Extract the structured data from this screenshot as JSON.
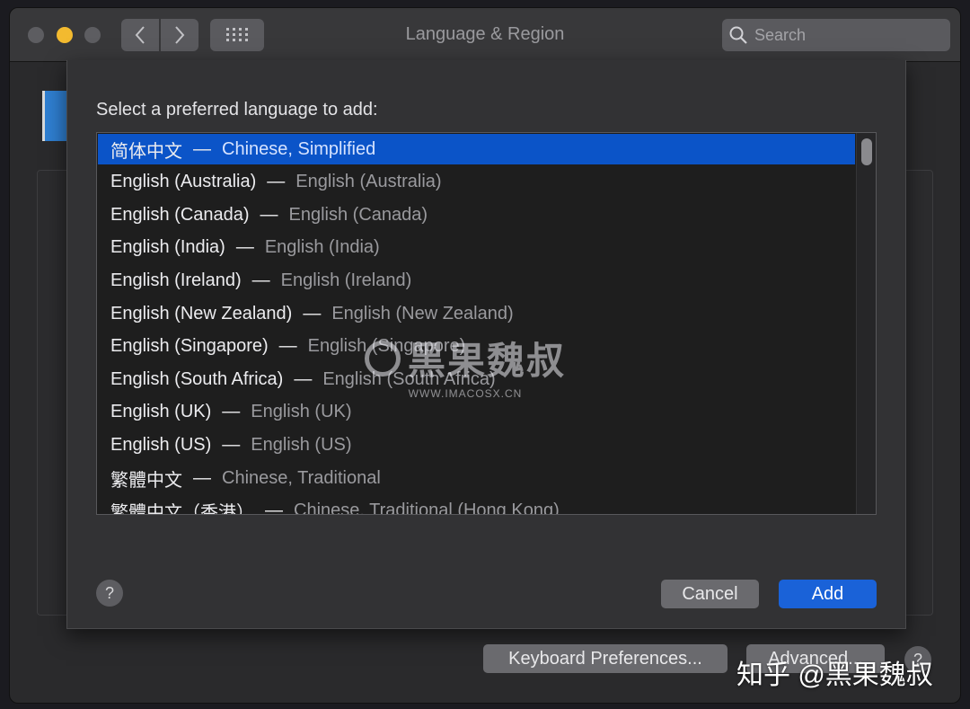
{
  "window": {
    "title": "Language & Region"
  },
  "search": {
    "placeholder": "Search"
  },
  "sheet": {
    "prompt": "Select a preferred language to add:",
    "languages": [
      {
        "native": "简体中文",
        "english": "Chinese, Simplified",
        "selected": true
      },
      {
        "native": "English (Australia)",
        "english": "English (Australia)"
      },
      {
        "native": "English (Canada)",
        "english": "English (Canada)"
      },
      {
        "native": "English (India)",
        "english": "English (India)"
      },
      {
        "native": "English (Ireland)",
        "english": "English (Ireland)"
      },
      {
        "native": "English (New Zealand)",
        "english": "English (New Zealand)"
      },
      {
        "native": "English (Singapore)",
        "english": "English (Singapore)"
      },
      {
        "native": "English (South Africa)",
        "english": "English (South Africa)"
      },
      {
        "native": "English (UK)",
        "english": "English (UK)"
      },
      {
        "native": "English (US)",
        "english": "English (US)"
      },
      {
        "native": "繁體中文",
        "english": "Chinese, Traditional"
      },
      {
        "native": "繁體中文（香港）",
        "english": "Chinese, Traditional (Hong Kong)"
      }
    ],
    "dash": "—",
    "help_label": "?",
    "cancel_label": "Cancel",
    "add_label": "Add"
  },
  "footer": {
    "keyboard_label": "Keyboard Preferences...",
    "advanced_label": "Advanced...",
    "help_label": "?"
  },
  "watermark": {
    "title": "黑果魏叔",
    "subtitle": "WWW.IMACOSX.CN"
  },
  "credit": "知乎 @黑果魏叔",
  "colors": {
    "selection": "#0b54c8",
    "add_button": "#1a62d8",
    "minimize": "#f3ba2f"
  }
}
